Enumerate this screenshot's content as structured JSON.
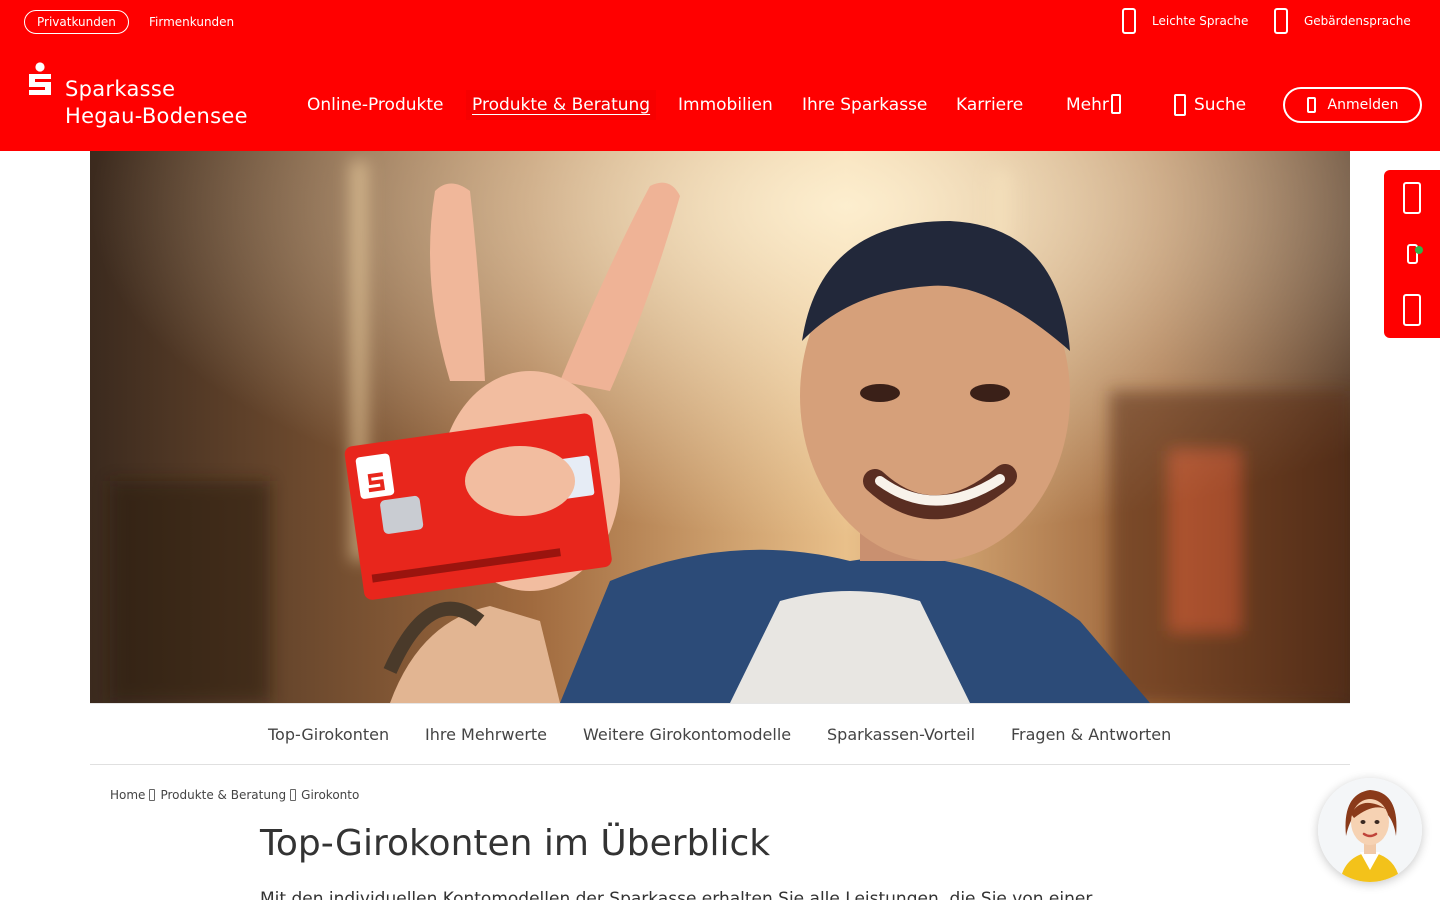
{
  "colors": {
    "brand": "#ff0000",
    "text": "#333333",
    "status_online": "#2fb14a"
  },
  "topbar": {
    "segment_private": "Privatkunden",
    "segment_business": "Firmenkunden",
    "easy_language": {
      "label": "Leichte Sprache",
      "icon": "easy-language-icon"
    },
    "sign_language": {
      "label": "Gebärdensprache",
      "icon": "sign-language-icon"
    }
  },
  "logo": {
    "line1": "Sparkasse",
    "line2": "Hegau-Bodensee",
    "icon": "sparkasse-s-logo"
  },
  "nav": {
    "items": [
      {
        "label": "Online-Produkte"
      },
      {
        "label": "Produkte & Beratung"
      },
      {
        "label": "Immobilien"
      },
      {
        "label": "Ihre Sparkasse"
      },
      {
        "label": "Karriere"
      },
      {
        "label": "Mehr"
      }
    ],
    "active_item": "Produkte & Beratung",
    "search_label": "Suche",
    "login_label": "Anmelden"
  },
  "hero": {
    "description": ""
  },
  "side_contact": {
    "buttons": [
      {
        "icon": "phone-icon"
      },
      {
        "icon": "chat-icon",
        "status": "online"
      },
      {
        "icon": "mail-icon"
      }
    ]
  },
  "anchor_nav": {
    "items": [
      {
        "label": "Top-Girokonten"
      },
      {
        "label": "Ihre Mehrwerte"
      },
      {
        "label": "Weitere Girokontomodelle"
      },
      {
        "label": "Sparkassen-Vorteil"
      },
      {
        "label": "Fragen & Antworten"
      }
    ]
  },
  "breadcrumb": {
    "items": [
      {
        "label": "Home"
      },
      {
        "label": "Produkte & Beratung"
      },
      {
        "label": "Girokonto"
      }
    ]
  },
  "main": {
    "title": "Top-Girokonten im Überblick",
    "intro": "Mit den individuellen Kontomodellen der Sparkasse erhalten Sie alle Leistungen, die Sie von einer"
  },
  "chat_avatar": {
    "icon": "chat-assistant-avatar"
  }
}
